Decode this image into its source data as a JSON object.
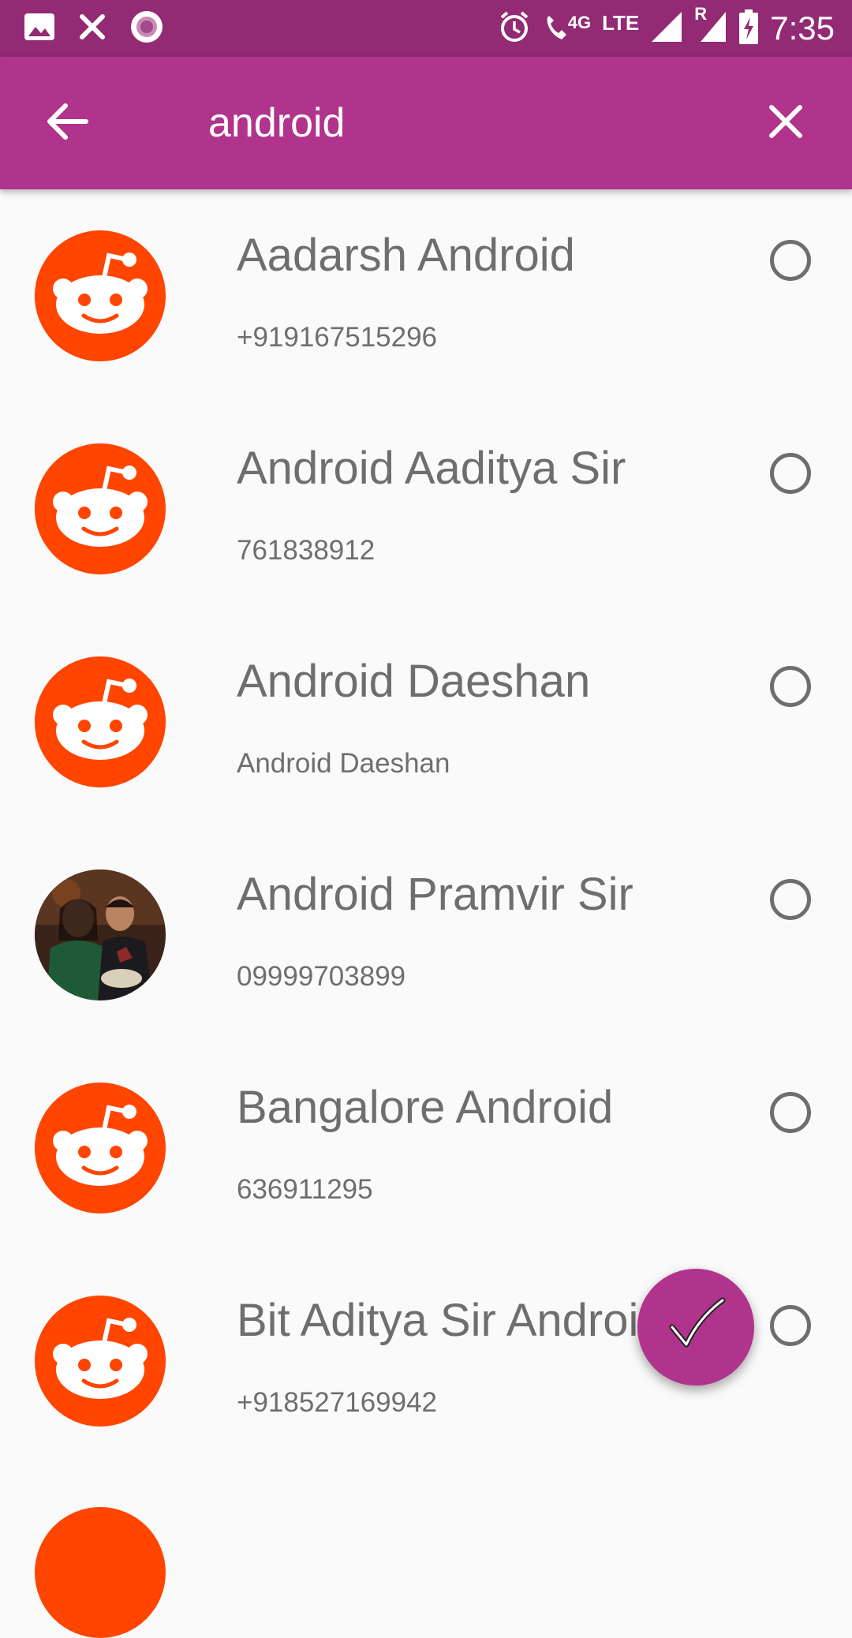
{
  "status_bar": {
    "time": "7:35",
    "network_4g": "4G",
    "network_lte": "LTE",
    "roaming": "R",
    "icons": [
      "image-icon",
      "close-notification-icon",
      "record-icon",
      "alarm-icon",
      "wifi-calling-icon",
      "signal-icon",
      "roaming-signal-icon",
      "battery-charging-icon"
    ]
  },
  "app_bar": {
    "search_value": "android",
    "back_icon": "arrow-back-icon",
    "clear_icon": "close-icon"
  },
  "colors": {
    "status_bar": "#922a74",
    "app_bar": "#b0338c",
    "fab": "#b0338c",
    "avatar_default": "#ff4500",
    "text": "#6e6e6e"
  },
  "contacts": [
    {
      "name": "Aadarsh Android",
      "detail": "+919167515296",
      "avatar": "reddit-alien-icon",
      "selected": false
    },
    {
      "name": "Android Aaditya Sir",
      "detail": "761838912",
      "avatar": "reddit-alien-icon",
      "selected": false
    },
    {
      "name": "Android Daeshan",
      "detail": "Android Daeshan",
      "avatar": "reddit-alien-icon",
      "selected": false
    },
    {
      "name": "Android Pramvir Sir",
      "detail": "09999703899",
      "avatar": "photo",
      "selected": false
    },
    {
      "name": "Bangalore Android",
      "detail": "636911295",
      "avatar": "reddit-alien-icon",
      "selected": false
    },
    {
      "name": "Bit Aditya Sir Android",
      "detail": "+918527169942",
      "avatar": "reddit-alien-icon",
      "selected": false
    }
  ],
  "fab": {
    "icon": "check-icon"
  }
}
